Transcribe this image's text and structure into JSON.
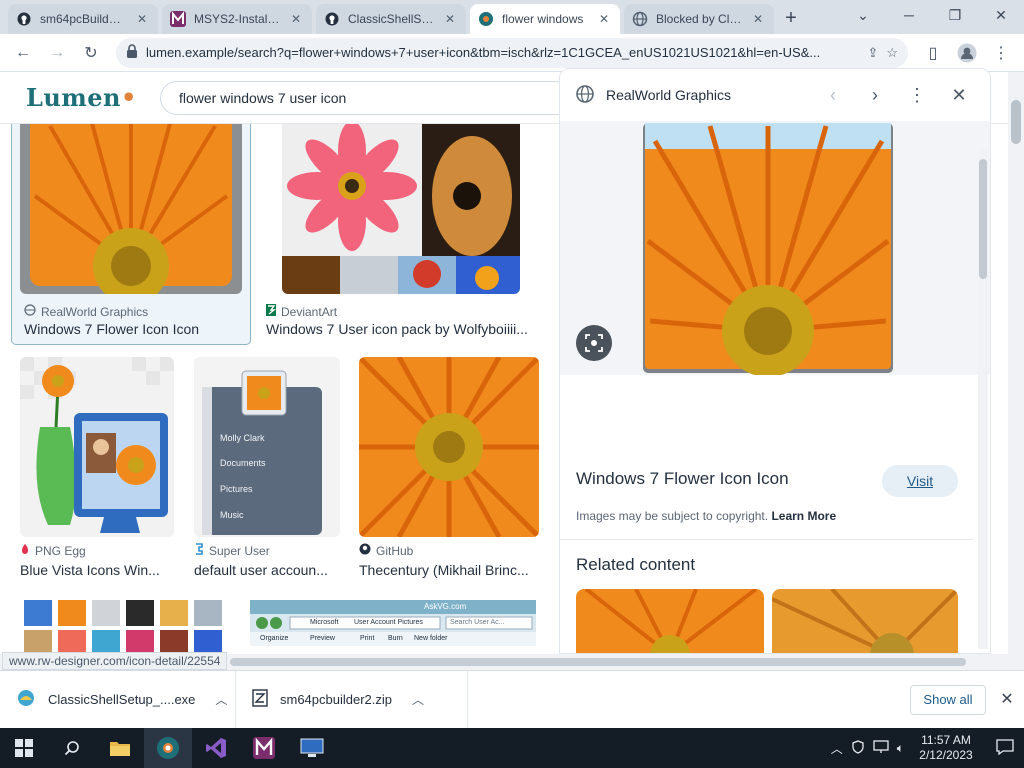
{
  "browser": {
    "tabs": [
      {
        "title": "sm64pcBuilder2",
        "icon": "code-host-icon",
        "active": false
      },
      {
        "title": "MSYS2-Installati",
        "icon": "letter-m-icon",
        "active": false
      },
      {
        "title": "ClassicShellSetu",
        "icon": "code-host-icon",
        "active": false
      },
      {
        "title": "flower windows",
        "icon": "search-engine-icon",
        "active": true
      },
      {
        "title": "Blocked by Clou",
        "icon": "globe-icon",
        "active": false
      }
    ],
    "new_tab_label": "+",
    "address_url": "lumen.example/search?q=flower+windows+7+user+icon&tbm=isch&rlz=1C1GCEA_enUS1021US1021&hl=en-US&..."
  },
  "search": {
    "wordmark": "Lumen",
    "query": "flower windows 7 user icon"
  },
  "results": [
    {
      "source": "RealWorld Graphics",
      "title": "Windows 7 Flower Icon Icon",
      "source_icon": "globe-icon",
      "selected": true
    },
    {
      "source": "DeviantArt",
      "title": "Windows 7 User icon pack by Wolfyboiiii...",
      "source_icon": "deviantart-icon",
      "selected": false
    },
    {
      "source": "PNG Egg",
      "title": "Blue Vista Icons Win...",
      "source_icon": "pngegg-icon",
      "selected": false
    },
    {
      "source": "Super User",
      "title": "default user accoun...",
      "source_icon": "superuser-icon",
      "selected": false
    },
    {
      "source": "GitHub",
      "title": "Thecentury (Mikhail Brinc...",
      "source_icon": "github-icon",
      "selected": false
    }
  ],
  "start_menu_mock": {
    "items": [
      "Molly Clark",
      "Documents",
      "Pictures",
      "Music"
    ]
  },
  "explorer_mock": {
    "site": "AskVG.com",
    "path": [
      "Microsoft",
      "User Account Pictures"
    ],
    "search_placeholder": "Search User Ac...",
    "buttons": [
      "Organize",
      "Preview",
      "Print",
      "Burn",
      "New folder"
    ]
  },
  "preview": {
    "source": "RealWorld Graphics",
    "title": "Windows 7 Flower Icon Icon",
    "visit_label": "Visit",
    "copyright_text": "Images may be subject to copyright.",
    "learn_more": "Learn More",
    "related_heading": "Related content"
  },
  "status_url": "www.rw-designer.com/icon-detail/22554",
  "downloads": [
    {
      "name": "ClassicShellSetup_....exe",
      "icon": "installer-icon"
    },
    {
      "name": "sm64pcbuilder2.zip",
      "icon": "zip-icon"
    }
  ],
  "downloads_show_all": "Show all",
  "taskbar": {
    "time": "11:57 AM",
    "date": "2/12/2023"
  },
  "colors": {
    "accent": "#1f6f78",
    "petal": "#f08a1c",
    "petal_dark": "#d9650b",
    "center": "#c9a21a",
    "taskbar": "#141c26"
  }
}
